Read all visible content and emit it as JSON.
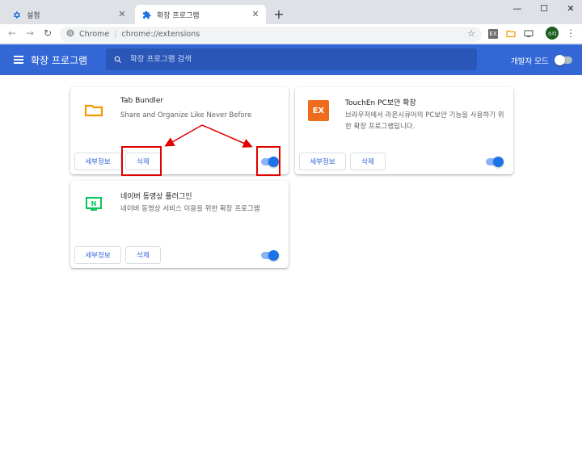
{
  "tabs": [
    {
      "title": "설정",
      "icon": "gear-icon",
      "active": false
    },
    {
      "title": "확장 프로그램",
      "icon": "puzzle-icon",
      "active": true
    }
  ],
  "toolbar": {
    "site_label": "Chrome",
    "url": "chrome://extensions",
    "profile_label": "소티"
  },
  "header": {
    "title": "확장 프로그램",
    "search_placeholder": "확장 프로그램 검색",
    "dev_mode_label": "개발자 모드",
    "dev_mode_on": false
  },
  "extensions": [
    {
      "name": "Tab Bundler",
      "description": "Share and Organize Like Never Before",
      "details_label": "세부정보",
      "remove_label": "삭제",
      "enabled": true,
      "icon": "folder-icon"
    },
    {
      "name": "TouchEn PC보안 확장",
      "description": "브라우저에서 라온시큐어의 PC보안 기능을 사용하기 위한 확장 프로그램입니다.",
      "details_label": "세부정보",
      "remove_label": "삭제",
      "enabled": true,
      "icon": "ex-icon",
      "icon_text": "EX"
    },
    {
      "name": "네이버 동영상 플러그인",
      "description": "네이버 동영상 서비스 이용을 위한 확장 프로그램",
      "details_label": "세부정보",
      "remove_label": "삭제",
      "enabled": true,
      "icon": "naver-video-icon",
      "icon_text": "N"
    }
  ],
  "colors": {
    "header_blue": "#3367d6",
    "accent": "#1a73e8",
    "annotation_red": "#e00000"
  }
}
